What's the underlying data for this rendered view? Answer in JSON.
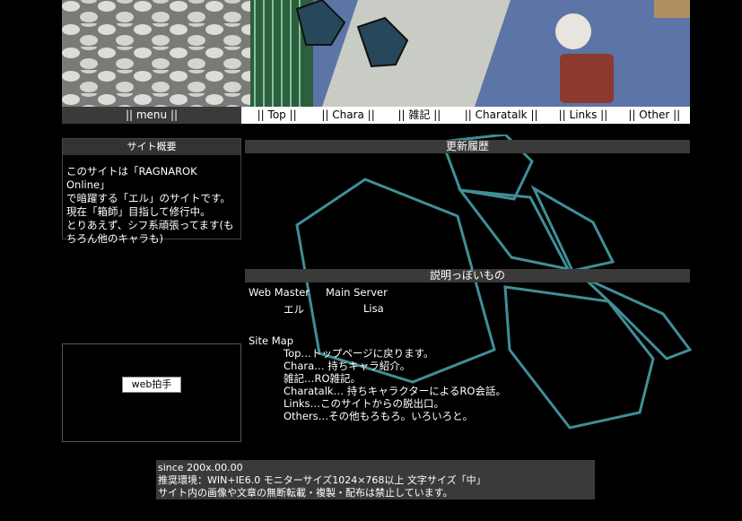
{
  "menu": {
    "label": "|| menu ||",
    "links": [
      "|| Top ||",
      "|| Chara ||",
      "|| 雑記 ||",
      "|| Charatalk ||",
      "|| Links ||",
      "|| Other ||"
    ]
  },
  "about": {
    "heading": "サイト概要",
    "lines": [
      "このサイトは「RAGNAROK Online」",
      "で暗躍する「エル」のサイトです。",
      "現在「箱師」目指して修行中。",
      "とりあえず、シフ系頑張ってます(も",
      "ちろん他のキャラも)"
    ]
  },
  "clap": {
    "label": "web拍手"
  },
  "updates": {
    "heading": "更新履歴"
  },
  "explain": {
    "heading": "説明っぽいもの",
    "webmaster_label": "Web Master",
    "server_label": "Main Server",
    "webmaster": "エル",
    "server": "Lisa",
    "sitemap_label": "Site Map",
    "sitemap": [
      "Top…トップページに戻ります。",
      "Chara… 持ちキャラ紹介。",
      "雑記…RO雑記。",
      "Charatalk… 持ちキャラクターによるRO会話。",
      "Links…このサイトからの脱出口。",
      "Others…その他もろもろ。いろいろと。"
    ]
  },
  "footer": {
    "lines": [
      "since 200x.00.00",
      "推奨環境：WIN+IE6.0 モニターサイズ1024×768以上 文字サイズ「中」",
      "サイト内の画像や文章の無断転載・複製・配布は禁止しています。"
    ]
  },
  "colors": {
    "accent": "#3a9aa8",
    "panel": "#3a3a3a"
  }
}
